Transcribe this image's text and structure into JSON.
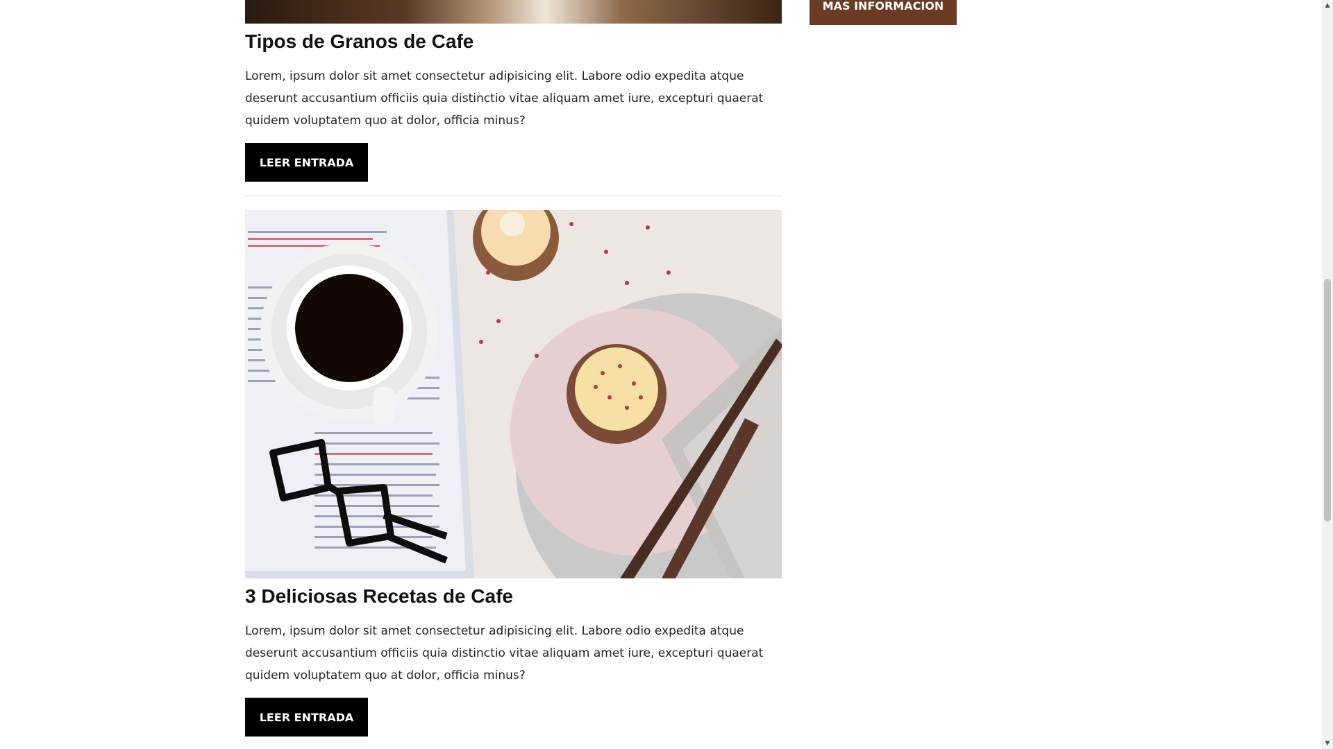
{
  "posts": [
    {
      "title": "Tipos de Granos de Cafe",
      "excerpt": "Lorem, ipsum dolor sit amet consectetur adipisicing elit. Labore odio expedita atque deserunt accusantium officiis quia distinctio vitae aliquam amet iure, excepturi quaerat quidem voluptatem quo at dolor, officia minus?",
      "button_label": "LEER ENTRADA"
    },
    {
      "title": "3 Deliciosas Recetas de Cafe",
      "excerpt": "Lorem, ipsum dolor sit amet consectetur adipisicing elit. Labore odio expedita atque deserunt accusantium officiis quia distinctio vitae aliquam amet iure, excepturi quaerat quidem voluptatem quo at dolor, officia minus?",
      "button_label": "LEER ENTRADA"
    }
  ],
  "sidebar": {
    "more_button_label": "MAS INFORMACION"
  },
  "colors": {
    "accent": "#6b3b24",
    "button": "#000000"
  },
  "icons": {
    "scroll_up": "chevron-up-icon",
    "scroll_down": "chevron-down-icon"
  }
}
